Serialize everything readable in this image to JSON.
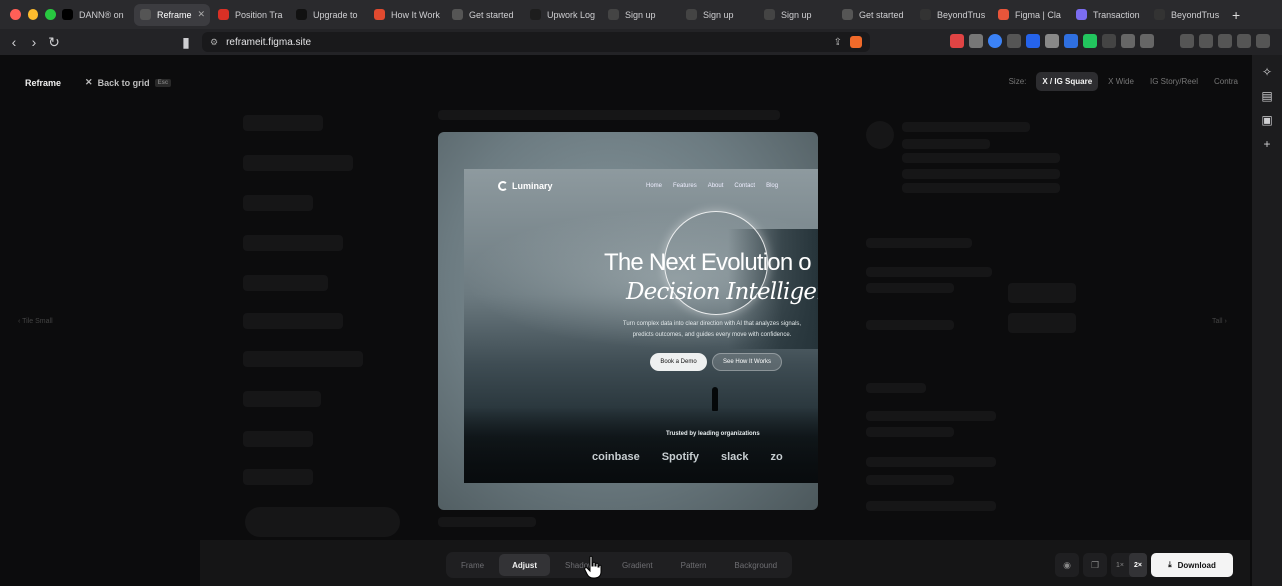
{
  "browser": {
    "tabs": [
      {
        "label": "DANN® on",
        "icon": "x-icon",
        "color": "#000000"
      },
      {
        "label": "Reframe",
        "icon": "globe-icon",
        "color": "#555555",
        "active": true
      },
      {
        "label": "Position Tra",
        "icon": "gmail-icon",
        "color": "#d93025"
      },
      {
        "label": "Upgrade to",
        "icon": "arrow-icon",
        "color": "#111111"
      },
      {
        "label": "How It Work",
        "icon": "app-icon",
        "color": "#e04a2f"
      },
      {
        "label": "Get started",
        "icon": "globe-icon",
        "color": "#555555"
      },
      {
        "label": "Upwork Log",
        "icon": "upwork-icon",
        "color": "#1d1d1d"
      },
      {
        "label": "Sign up",
        "icon": "move-icon",
        "color": "#444444"
      },
      {
        "label": "Sign up",
        "icon": "move-icon",
        "color": "#444444"
      },
      {
        "label": "Sign up",
        "icon": "move-icon",
        "color": "#444444"
      },
      {
        "label": "Get started",
        "icon": "globe-icon",
        "color": "#555555"
      },
      {
        "label": "BeyondTrus",
        "icon": "beyond-icon",
        "color": "#333333"
      },
      {
        "label": "Figma | Cla",
        "icon": "figma-icon",
        "color": "#e8553a"
      },
      {
        "label": "Transaction",
        "icon": "app-icon",
        "color": "#7b6cf0"
      },
      {
        "label": "BeyondTrus",
        "icon": "beyond-icon",
        "color": "#333333"
      }
    ],
    "new_tab": "+",
    "url": "reframeit.figma.site"
  },
  "app": {
    "brand": "Reframe",
    "back_label": "Back to grid",
    "back_key": "Esc",
    "size_label": "Size:",
    "sizes": [
      "X / IG Square",
      "X Wide",
      "IG Story/Reel",
      "Contra"
    ],
    "selected_size": "X / IG Square",
    "left_hint": "Tile Small",
    "right_hint": "Tall"
  },
  "preview": {
    "logo": "Luminary",
    "nav": [
      "Home",
      "Features",
      "About",
      "Contact",
      "Blog"
    ],
    "headline": "The Next Evolution o",
    "headline_italic": "Decision Intelligence",
    "subtext": "Turn complex data into clear direction with AI that analyzes signals, predicts outcomes, and guides every move with confidence.",
    "primary_cta": "Book a Demo",
    "secondary_cta": "See How It Works",
    "trusted": "Trusted by leading organizations",
    "brands": [
      "coinbase",
      "Spotify",
      "slack",
      "zo"
    ]
  },
  "dock": {
    "tabs": [
      "Frame",
      "Adjust",
      "Shadow",
      "Gradient",
      "Pattern",
      "Background"
    ],
    "active_tab": "Adjust",
    "scale": [
      "1×",
      "2×"
    ],
    "active_scale": "2×",
    "download": "Download"
  }
}
